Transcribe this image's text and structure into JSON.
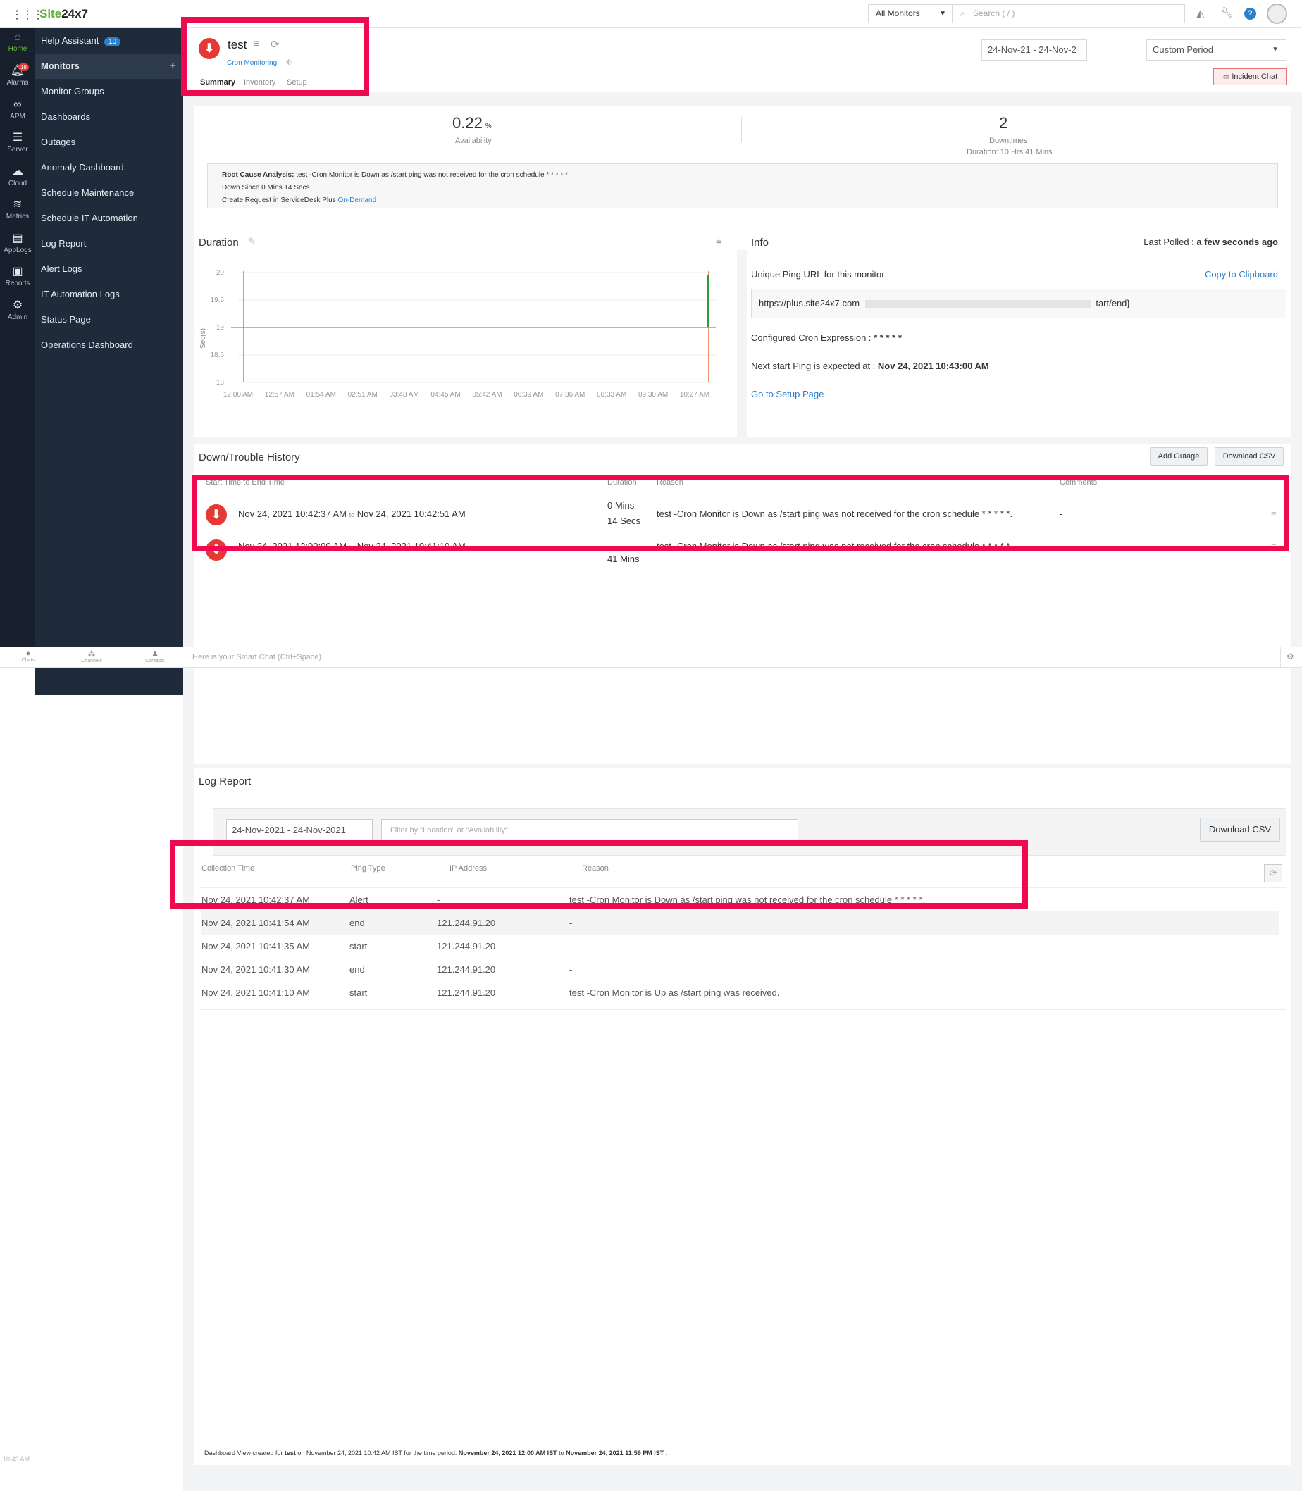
{
  "topbar": {
    "brand_part1": "Site",
    "brand_part2": "24x7",
    "monitor_select": "All Monitors",
    "search_placeholder": "Search ( / )"
  },
  "rail": [
    {
      "label": "Home",
      "icon": "home-icon"
    },
    {
      "label": "Alarms",
      "icon": "bell-icon",
      "badge": "18"
    },
    {
      "label": "APM",
      "icon": "binoculars-icon"
    },
    {
      "label": "Server",
      "icon": "server-icon"
    },
    {
      "label": "Cloud",
      "icon": "cloud-icon"
    },
    {
      "label": "Metrics",
      "icon": "layers-icon"
    },
    {
      "label": "AppLogs",
      "icon": "log-icon"
    },
    {
      "label": "Reports",
      "icon": "report-icon"
    },
    {
      "label": "Admin",
      "icon": "gear-icon"
    }
  ],
  "sidebar": {
    "items": [
      {
        "label": "Help Assistant",
        "badge": "10"
      },
      {
        "label": "Monitors"
      },
      {
        "label": "Monitor Groups"
      },
      {
        "label": "Dashboards"
      },
      {
        "label": "Outages"
      },
      {
        "label": "Anomaly Dashboard"
      },
      {
        "label": "Schedule Maintenance"
      },
      {
        "label": "Schedule IT Automation"
      },
      {
        "label": "Log Report"
      },
      {
        "label": "Alert Logs"
      },
      {
        "label": "IT Automation Logs"
      },
      {
        "label": "Status Page"
      },
      {
        "label": "Operations Dashboard"
      }
    ],
    "time": "10:43 AM"
  },
  "monitor": {
    "name": "test",
    "type": "Cron Monitoring",
    "tabs": [
      "Summary",
      "Inventory",
      "Setup"
    ],
    "date_range": "24-Nov-21 - 24-Nov-2",
    "period": "Custom Period",
    "incident_chat": "Incident Chat"
  },
  "summary": {
    "availability_value": "0.22",
    "availability_unit": "%",
    "availability_label": "Availability",
    "downtimes_value": "2",
    "downtimes_label": "Downtimes",
    "downtimes_duration": "Duration: 10 Hrs 41 Mins",
    "rca_label": "Root Cause Analysis:",
    "rca_text": " test -Cron Monitor is Down as /start ping was not received for the cron schedule * * * * *.",
    "down_since": "Down Since 0 Mins 14 Secs",
    "create_request": "Create Request in ServiceDesk Plus ",
    "on_demand": "On-Demand"
  },
  "duration_chart": {
    "title": "Duration",
    "ylabel": "Sec(s)"
  },
  "chart_data": {
    "type": "line",
    "title": "Duration",
    "ylabel": "Sec(s)",
    "xlabel": "",
    "yticks": [
      "20",
      "19.5",
      "19",
      "18.5",
      "18"
    ],
    "ylim": [
      18,
      20
    ],
    "xticks": [
      "12:00 AM",
      "12:57 AM",
      "01:54 AM",
      "02:51 AM",
      "03:48 AM",
      "04:45 AM",
      "05:42 AM",
      "06:39 AM",
      "07:36 AM",
      "08:33 AM",
      "09:30 AM",
      "10:27 AM"
    ],
    "series": [
      {
        "values": [
          19,
          19
        ],
        "color": "#f08a24"
      }
    ],
    "markers": [
      {
        "color": "#f26a3c"
      },
      {
        "color": "#2e9b3b"
      }
    ]
  },
  "info": {
    "title": "Info",
    "last_polled_label": "Last Polled : ",
    "last_polled_value": "a few seconds ago",
    "ping_url_label": "Unique Ping URL for this monitor",
    "copy": "Copy to Clipboard",
    "url_start": "https://plus.site24x7.com",
    "url_end": "tart/end}",
    "cron_label": "Configured Cron Expression : ",
    "cron_value": "* * * * *",
    "next_ping_label": "Next start Ping is expected at : ",
    "next_ping_value": "Nov 24, 2021 10:43:00 AM",
    "setup_link": "Go to Setup Page"
  },
  "history": {
    "title": "Down/Trouble History",
    "add_outage": "Add Outage",
    "download_csv": "Download CSV",
    "columns": [
      "Start Time to End Time",
      "Duration",
      "Reason",
      "Comments"
    ],
    "rows": [
      {
        "start": "Nov 24, 2021 10:42:37 AM",
        "to": "to",
        "end": "Nov 24, 2021 10:42:51 AM",
        "dur1": "0 Mins",
        "dur2": "14 Secs",
        "reason": "test -Cron Monitor is Down as /start ping was not received for the cron schedule * * * * *.",
        "comment": "-"
      },
      {
        "start": "Nov 24, 2021 12:00:00 AM",
        "to": "to",
        "end": "Nov 24, 2021 10:41:10 AM",
        "dur1": "",
        "dur2": "41 Mins",
        "reason": "test -Cron Monitor is Down as /start ping was not received for the cron schedule * * * * *.",
        "comment": "-"
      }
    ]
  },
  "chatbar": {
    "tabs": [
      "Chats",
      "Channels",
      "Contacts"
    ],
    "placeholder": "Here is your Smart Chat (Ctrl+Space)"
  },
  "log_report": {
    "title": "Log Report",
    "date": "24-Nov-2021 - 24-Nov-2021",
    "filter_placeholder": "Filter by \"Location\" or \"Availability\"",
    "download_csv": "Download CSV",
    "columns": [
      "Collection Time",
      "Ping Type",
      "IP Address",
      "Reason"
    ],
    "rows": [
      {
        "time": "Nov 24, 2021 10:42:37 AM",
        "type": "Alert",
        "ip": "-",
        "reason": "test -Cron Monitor is Down as /start ping was not received for the cron schedule * * * * *."
      },
      {
        "time": "Nov 24, 2021 10:41:54 AM",
        "type": "end",
        "ip": "121.244.91.20",
        "reason": "-"
      },
      {
        "time": "Nov 24, 2021 10:41:35 AM",
        "type": "start",
        "ip": "121.244.91.20",
        "reason": "-"
      },
      {
        "time": "Nov 24, 2021 10:41:30 AM",
        "type": "end",
        "ip": "121.244.91.20",
        "reason": "-"
      },
      {
        "time": "Nov 24, 2021 10:41:10 AM",
        "type": "start",
        "ip": "121.244.91.20",
        "reason": "test -Cron Monitor is Up as  /start ping was received."
      }
    ]
  },
  "footer": {
    "p1": "Dashboard View created for ",
    "name": "test",
    "p2": " on November 24, 2021 10:42 AM IST for the time period: ",
    "from": "November 24, 2021 12:00 AM IST",
    "p3": " to ",
    "to": "November 24, 2021 11:59 PM IST",
    "p4": " ."
  },
  "colors": {
    "accent_red": "#e53935",
    "highlight": "#f0094f",
    "sidebar_bg": "#1f2b3a",
    "link_blue": "#2d7fc9",
    "brand_green": "#5fb336"
  }
}
